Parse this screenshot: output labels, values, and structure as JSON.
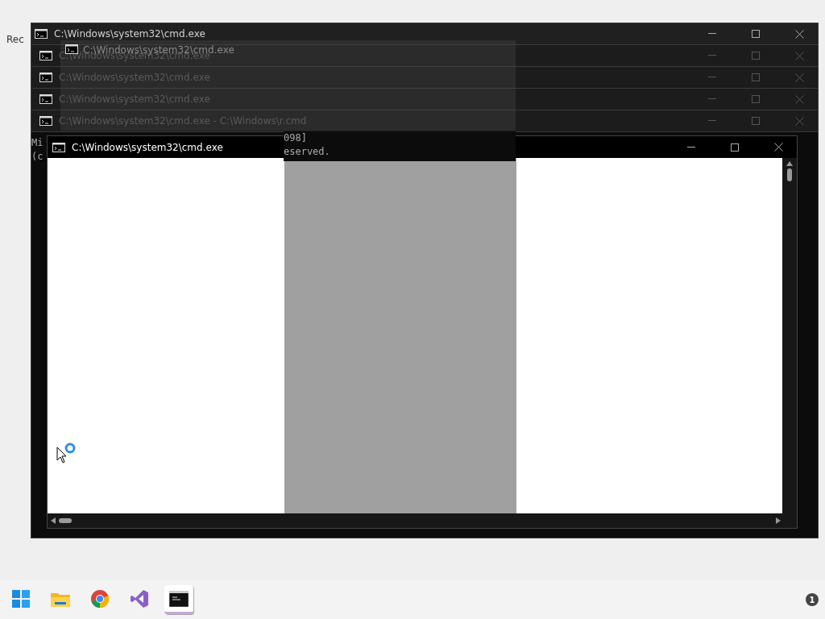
{
  "desktop": {
    "icon_label": "Rec"
  },
  "stacked_windows": [
    {
      "title": "C:\\Windows\\system32\\cmd.exe"
    },
    {
      "title": "C:\\Windows\\system32\\cmd.exe"
    },
    {
      "title": "C:\\Windows\\system32\\cmd.exe"
    },
    {
      "title": "C:\\Windows\\system32\\cmd.exe"
    },
    {
      "title": "C:\\Windows\\system32\\cmd.exe - C:\\Windows\\r.cmd"
    }
  ],
  "ghost_window": {
    "title": "C:\\Windows\\system32\\cmd.exe"
  },
  "console_fragments": [
    {
      "left": "Mi",
      "right": "098]"
    },
    {
      "left": "(c",
      "right": "eserved."
    }
  ],
  "front_window": {
    "title": "C:\\Windows\\system32\\cmd.exe"
  },
  "taskbar": {
    "apps": [
      {
        "kind": "start",
        "selected": false
      },
      {
        "kind": "folder",
        "selected": false
      },
      {
        "kind": "browser",
        "selected": false
      },
      {
        "kind": "ide",
        "selected": false
      },
      {
        "kind": "terminal",
        "selected": true
      }
    ],
    "notification_count": "1"
  }
}
